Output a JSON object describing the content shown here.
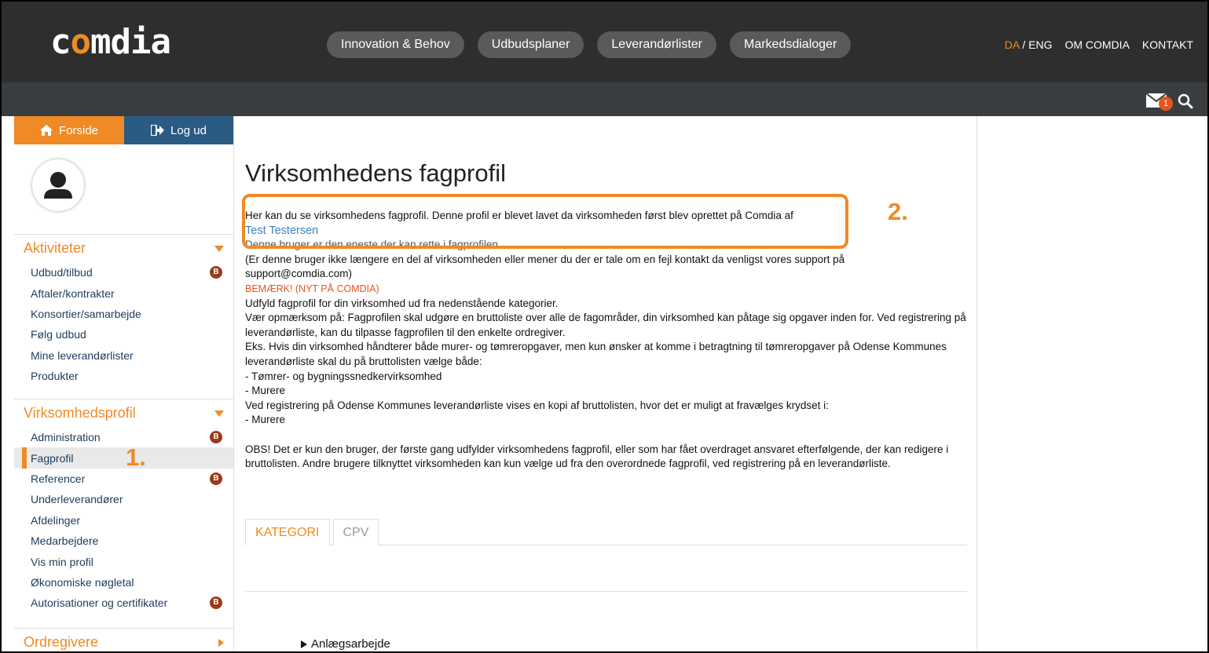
{
  "logo": {
    "part1": "c",
    "accent": "o",
    "part2": "mdia"
  },
  "nav": {
    "items": [
      "Innovation & Behov",
      "Udbudsplaner",
      "Leverandørlister",
      "Markedsdialoger"
    ]
  },
  "toplinks": {
    "da": "DA",
    "sep": "/",
    "eng": "ENG",
    "about": "OM COMDIA",
    "contact": "KONTAKT"
  },
  "notifications": {
    "count": "1"
  },
  "sidebar": {
    "home_label": "Forside",
    "logout_label": "Log ud",
    "sections": [
      {
        "title": "Aktiviteter",
        "items": [
          {
            "label": "Udbud/tilbud",
            "badge": "B"
          },
          {
            "label": "Aftaler/kontrakter"
          },
          {
            "label": "Konsortier/samarbejde"
          },
          {
            "label": "Følg udbud"
          },
          {
            "label": "Mine leverandørlister"
          },
          {
            "label": "Produkter"
          }
        ]
      },
      {
        "title": "Virksomhedsprofil",
        "items": [
          {
            "label": "Administration",
            "badge": "B"
          },
          {
            "label": "Fagprofil",
            "active": true
          },
          {
            "label": "Referencer",
            "badge": "B"
          },
          {
            "label": "Underleverandører"
          },
          {
            "label": "Afdelinger"
          },
          {
            "label": "Medarbejdere"
          },
          {
            "label": "Vis min profil"
          },
          {
            "label": "Økonomiske nøgletal"
          },
          {
            "label": "Autorisationer og certifikater",
            "badge": "B"
          }
        ]
      },
      {
        "title": "Ordregivere",
        "items": []
      }
    ]
  },
  "main": {
    "title": "Virksomhedens fagprofil",
    "intro": "Her kan du se virksomhedens fagprofil. Denne profil er blevet lavet da virksomheden først blev oprettet på Comdia af",
    "creator": "Test Testersen",
    "only_user": "Denne bruger er den eneste der kan rette i fagprofilen.",
    "support_line": "(Er denne bruger ikke længere en del af virksomheden eller mener du der er tale om en fejl kontakt da venligst vores support på",
    "support_email": "support@comdia.com)",
    "notice": "BEMÆRK! (NYT PÅ COMDIA)",
    "p1": "Udfyld fagprofil for din virksomhed ud fra nedenstående kategorier.",
    "p2": "Vær opmærksom på: Fagprofilen skal udgøre en bruttoliste over alle de fagområder, din virksomhed kan påtage sig opgaver inden for. Ved registrering på leverandørliste, kan du tilpasse fagprofilen til den enkelte ordregiver.",
    "p3": "Eks. Hvis din virksomhed håndterer både murer- og tømreropgaver, men kun ønsker at komme i betragtning til tømreropgaver på Odense Kommunes leverandørliste skal du på bruttolisten vælge både:",
    "p4": "- Tømrer- og bygningssnedkervirksomhed",
    "p5": "- Murere",
    "p6": "Ved registrering på Odense Kommunes leverandørliste vises en kopi af bruttolisten, hvor det er muligt at fravælges krydset i:",
    "p7": "- Murere",
    "p8": "OBS! Det er kun den bruger, der første gang udfylder virksomhedens fagprofil, eller som har fået overdraget ansvaret efterfølgende, der kan redigere i bruttolisten. Andre brugere tilknyttet virksomheden kan kun vælge ud fra den overordnede fagprofil, ved registrering på en leverandørliste.",
    "tabs": [
      "KATEGORI",
      "CPV"
    ],
    "tree_first": "Anlægsarbejde"
  },
  "annotations": {
    "one": "1.",
    "two": "2."
  },
  "colors": {
    "accent": "#f08a24",
    "header": "#2e2e2e",
    "logout_tab": "#2b5a83",
    "badge": "#9c3a1a"
  }
}
